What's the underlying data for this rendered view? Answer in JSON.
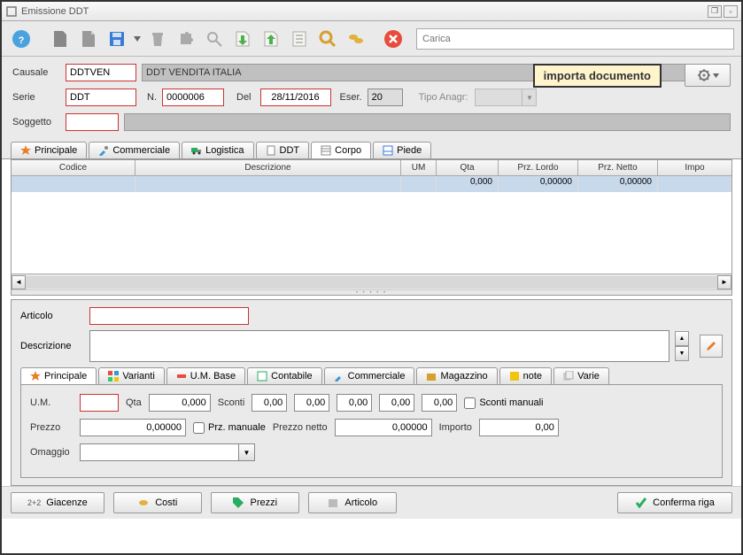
{
  "window": {
    "title": "Emissione DDT"
  },
  "toolbar": {
    "search_placeholder": "Carica"
  },
  "header": {
    "causale_label": "Causale",
    "causale_value": "DDTVEN",
    "causale_desc": "DDT VENDITA ITALIA",
    "serie_label": "Serie",
    "serie_value": "DDT",
    "n_label": "N.",
    "n_value": "0000006",
    "del_label": "Del",
    "del_value": "28/11/2016",
    "eser_label": "Eser.",
    "eser_value": "20",
    "tipo_label": "Tipo Anagr:",
    "soggetto_label": "Soggetto",
    "soggetto_value": ""
  },
  "callout": "importa documento",
  "tabs": {
    "principale": "Principale",
    "commerciale": "Commerciale",
    "logistica": "Logistica",
    "ddt": "DDT",
    "corpo": "Corpo",
    "piede": "Piede"
  },
  "grid": {
    "headers": {
      "codice": "Codice",
      "descrizione": "Descrizione",
      "um": "UM",
      "qta": "Qta",
      "przlordo": "Prz. Lordo",
      "prznetto": "Prz. Netto",
      "impo": "Impo"
    },
    "row1": {
      "qta": "0,000",
      "przlordo": "0,00000",
      "prznetto": "0,00000"
    }
  },
  "detail": {
    "articolo_label": "Articolo",
    "articolo_value": "",
    "descrizione_label": "Descrizione",
    "descrizione_value": ""
  },
  "subtabs": {
    "principale": "Principale",
    "varianti": "Varianti",
    "umbase": "U.M. Base",
    "contabile": "Contabile",
    "commerciale": "Commerciale",
    "magazzino": "Magazzino",
    "note": "note",
    "varie": "Varie"
  },
  "fields": {
    "um_label": "U.M.",
    "um_value": "",
    "qta_label": "Qta",
    "qta_value": "0,000",
    "sconti_label": "Sconti",
    "sconto1": "0,00",
    "sconto2": "0,00",
    "sconto3": "0,00",
    "sconto4": "0,00",
    "sconto5": "0,00",
    "sconti_manuali_label": "Sconti manuali",
    "prezzo_label": "Prezzo",
    "prezzo_value": "0,00000",
    "prz_manuale_label": "Prz. manuale",
    "prezzo_netto_label": "Prezzo netto",
    "prezzo_netto_value": "0,00000",
    "importo_label": "Importo",
    "importo_value": "0,00",
    "omaggio_label": "Omaggio",
    "omaggio_value": ""
  },
  "buttons": {
    "giacenze": "Giacenze",
    "costi": "Costi",
    "prezzi": "Prezzi",
    "articolo": "Articolo",
    "conferma": "Conferma riga"
  }
}
